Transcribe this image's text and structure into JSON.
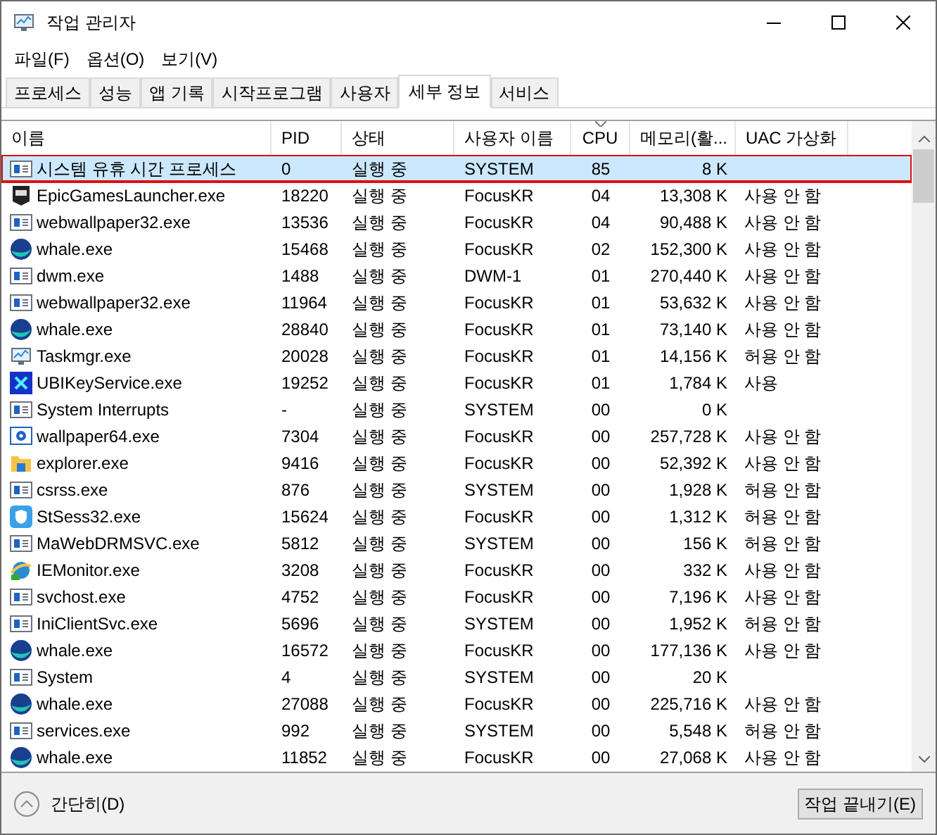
{
  "window": {
    "title": "작업 관리자"
  },
  "menu": [
    "파일(F)",
    "옵션(O)",
    "보기(V)"
  ],
  "tabs": [
    {
      "label": "프로세스",
      "selected": false
    },
    {
      "label": "성능",
      "selected": false
    },
    {
      "label": "앱 기록",
      "selected": false
    },
    {
      "label": "시작프로그램",
      "selected": false
    },
    {
      "label": "사용자",
      "selected": false
    },
    {
      "label": "세부 정보",
      "selected": true
    },
    {
      "label": "서비스",
      "selected": false
    }
  ],
  "table": {
    "columns": [
      {
        "label": "이름",
        "sorted": false
      },
      {
        "label": "PID",
        "sorted": false
      },
      {
        "label": "상태",
        "sorted": false
      },
      {
        "label": "사용자 이름",
        "sorted": false
      },
      {
        "label": "CPU",
        "sorted": true
      },
      {
        "label": "메모리(활...",
        "sorted": false
      },
      {
        "label": "UAC 가상화",
        "sorted": false
      }
    ],
    "rows": [
      {
        "kind": "window",
        "name": "시스템 유휴 시간 프로세스",
        "pid": "0",
        "status": "실행 중",
        "user": "SYSTEM",
        "cpu": "85",
        "memory": "8 K",
        "uac": "",
        "selected": true
      },
      {
        "kind": "epic",
        "name": "EpicGamesLauncher.exe",
        "pid": "18220",
        "status": "실행 중",
        "user": "FocusKR",
        "cpu": "04",
        "memory": "13,308 K",
        "uac": "사용 안 함",
        "selected": false
      },
      {
        "kind": "window",
        "name": "webwallpaper32.exe",
        "pid": "13536",
        "status": "실행 중",
        "user": "FocusKR",
        "cpu": "04",
        "memory": "90,488 K",
        "uac": "사용 안 함",
        "selected": false
      },
      {
        "kind": "whale",
        "name": "whale.exe",
        "pid": "15468",
        "status": "실행 중",
        "user": "FocusKR",
        "cpu": "02",
        "memory": "152,300 K",
        "uac": "사용 안 함",
        "selected": false
      },
      {
        "kind": "window",
        "name": "dwm.exe",
        "pid": "1488",
        "status": "실행 중",
        "user": "DWM-1",
        "cpu": "01",
        "memory": "270,440 K",
        "uac": "사용 안 함",
        "selected": false
      },
      {
        "kind": "window",
        "name": "webwallpaper32.exe",
        "pid": "11964",
        "status": "실행 중",
        "user": "FocusKR",
        "cpu": "01",
        "memory": "53,632 K",
        "uac": "사용 안 함",
        "selected": false
      },
      {
        "kind": "whale",
        "name": "whale.exe",
        "pid": "28840",
        "status": "실행 중",
        "user": "FocusKR",
        "cpu": "01",
        "memory": "73,140 K",
        "uac": "사용 안 함",
        "selected": false
      },
      {
        "kind": "monitor",
        "name": "Taskmgr.exe",
        "pid": "20028",
        "status": "실행 중",
        "user": "FocusKR",
        "cpu": "01",
        "memory": "14,156 K",
        "uac": "허용 안 함",
        "selected": false
      },
      {
        "kind": "ubi",
        "name": "UBIKeyService.exe",
        "pid": "19252",
        "status": "실행 중",
        "user": "FocusKR",
        "cpu": "01",
        "memory": "1,784 K",
        "uac": "사용",
        "selected": false
      },
      {
        "kind": "window",
        "name": "System Interrupts",
        "pid": "-",
        "status": "실행 중",
        "user": "SYSTEM",
        "cpu": "00",
        "memory": "0 K",
        "uac": "",
        "selected": false
      },
      {
        "kind": "gear",
        "name": "wallpaper64.exe",
        "pid": "7304",
        "status": "실행 중",
        "user": "FocusKR",
        "cpu": "00",
        "memory": "257,728 K",
        "uac": "사용 안 함",
        "selected": false
      },
      {
        "kind": "folder",
        "name": "explorer.exe",
        "pid": "9416",
        "status": "실행 중",
        "user": "FocusKR",
        "cpu": "00",
        "memory": "52,392 K",
        "uac": "사용 안 함",
        "selected": false
      },
      {
        "kind": "window",
        "name": "csrss.exe",
        "pid": "876",
        "status": "실행 중",
        "user": "SYSTEM",
        "cpu": "00",
        "memory": "1,928 K",
        "uac": "허용 안 함",
        "selected": false
      },
      {
        "kind": "shield",
        "name": "StSess32.exe",
        "pid": "15624",
        "status": "실행 중",
        "user": "FocusKR",
        "cpu": "00",
        "memory": "1,312 K",
        "uac": "허용 안 함",
        "selected": false
      },
      {
        "kind": "window",
        "name": "MaWebDRMSVC.exe",
        "pid": "5812",
        "status": "실행 중",
        "user": "SYSTEM",
        "cpu": "00",
        "memory": "156 K",
        "uac": "허용 안 함",
        "selected": false
      },
      {
        "kind": "globe",
        "name": "IEMonitor.exe",
        "pid": "3208",
        "status": "실행 중",
        "user": "FocusKR",
        "cpu": "00",
        "memory": "332 K",
        "uac": "사용 안 함",
        "selected": false
      },
      {
        "kind": "window",
        "name": "svchost.exe",
        "pid": "4752",
        "status": "실행 중",
        "user": "FocusKR",
        "cpu": "00",
        "memory": "7,196 K",
        "uac": "사용 안 함",
        "selected": false
      },
      {
        "kind": "window",
        "name": "IniClientSvc.exe",
        "pid": "5696",
        "status": "실행 중",
        "user": "SYSTEM",
        "cpu": "00",
        "memory": "1,952 K",
        "uac": "허용 안 함",
        "selected": false
      },
      {
        "kind": "whale",
        "name": "whale.exe",
        "pid": "16572",
        "status": "실행 중",
        "user": "FocusKR",
        "cpu": "00",
        "memory": "177,136 K",
        "uac": "사용 안 함",
        "selected": false
      },
      {
        "kind": "window",
        "name": "System",
        "pid": "4",
        "status": "실행 중",
        "user": "SYSTEM",
        "cpu": "00",
        "memory": "20 K",
        "uac": "",
        "selected": false
      },
      {
        "kind": "whale",
        "name": "whale.exe",
        "pid": "27088",
        "status": "실행 중",
        "user": "FocusKR",
        "cpu": "00",
        "memory": "225,716 K",
        "uac": "사용 안 함",
        "selected": false
      },
      {
        "kind": "window",
        "name": "services.exe",
        "pid": "992",
        "status": "실행 중",
        "user": "SYSTEM",
        "cpu": "00",
        "memory": "5,548 K",
        "uac": "허용 안 함",
        "selected": false
      },
      {
        "kind": "whale",
        "name": "whale.exe",
        "pid": "11852",
        "status": "실행 중",
        "user": "FocusKR",
        "cpu": "00",
        "memory": "27,068 K",
        "uac": "사용 안 함",
        "selected": false
      }
    ]
  },
  "footer": {
    "collapse_label": "간단히(D)",
    "end_task_label": "작업 끝내기(E)"
  }
}
